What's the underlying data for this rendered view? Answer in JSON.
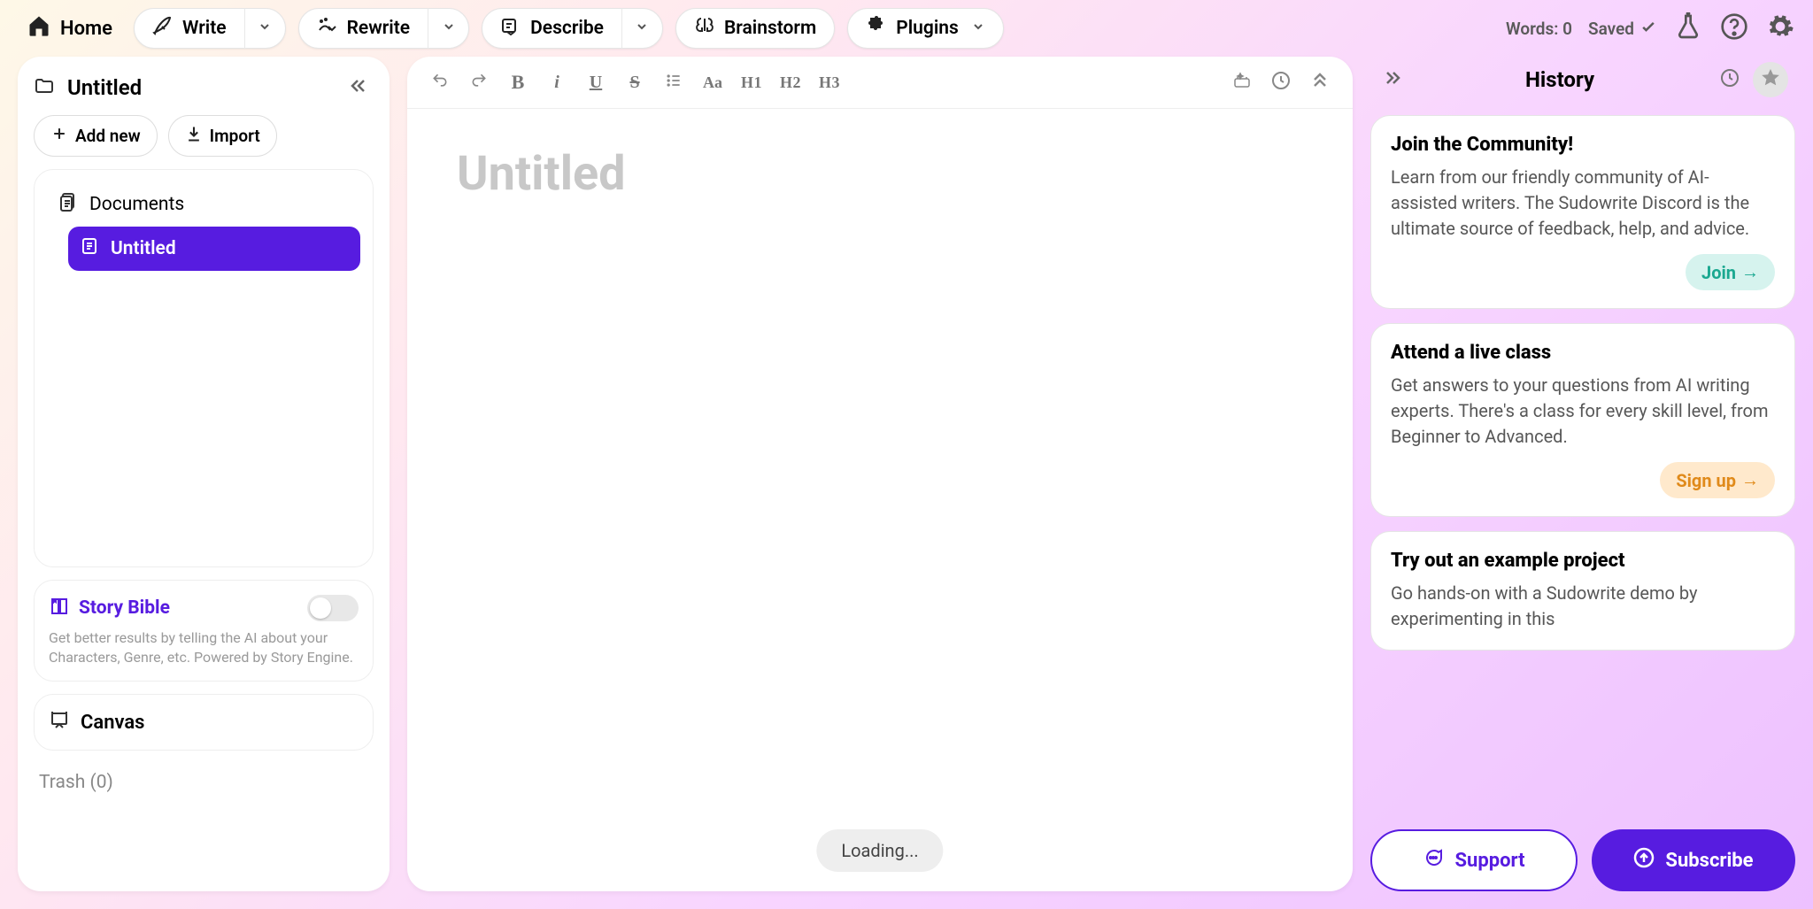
{
  "topbar": {
    "home_label": "Home",
    "tools": [
      {
        "id": "write",
        "label": "Write",
        "has_dropdown": true
      },
      {
        "id": "rewrite",
        "label": "Rewrite",
        "has_dropdown": true
      },
      {
        "id": "describe",
        "label": "Describe",
        "has_dropdown": true
      },
      {
        "id": "brainstorm",
        "label": "Brainstorm",
        "has_dropdown": false
      },
      {
        "id": "plugins",
        "label": "Plugins",
        "has_dropdown": false,
        "trailing_caret": true
      }
    ],
    "words_label": "Words: 0",
    "saved_label": "Saved"
  },
  "sidebar": {
    "project_title": "Untitled",
    "add_new_label": "Add new",
    "import_label": "Import",
    "documents_label": "Documents",
    "items": [
      {
        "label": "Untitled",
        "active": true
      }
    ],
    "story_bible": {
      "title": "Story Bible",
      "description": "Get better results by telling the AI about your Characters, Genre, etc. Powered by Story Engine."
    },
    "canvas_label": "Canvas",
    "trash_label": "Trash (0)"
  },
  "editor": {
    "title_placeholder": "Untitled",
    "loading_label": "Loading...",
    "toolbar": {
      "h1": "H1",
      "h2": "H2",
      "h3": "H3",
      "aa": "Aa"
    }
  },
  "rightpanel": {
    "title": "History",
    "cards": [
      {
        "title": "Join the Community!",
        "body": "Learn from our friendly community of AI-assisted writers. The Sudowrite Discord is the ultimate source of feedback, help, and advice.",
        "cta_label": "Join",
        "cta_style": "teal"
      },
      {
        "title": "Attend a live class",
        "body": "Get answers to your questions from AI writing experts. There's a class for every skill level, from Beginner to Advanced.",
        "cta_label": "Sign up",
        "cta_style": "orange"
      },
      {
        "title": "Try out an example project",
        "body": "Go hands-on with a Sudowrite demo by experimenting in this",
        "cta_label": "",
        "cta_style": ""
      }
    ],
    "support_label": "Support",
    "subscribe_label": "Subscribe"
  }
}
